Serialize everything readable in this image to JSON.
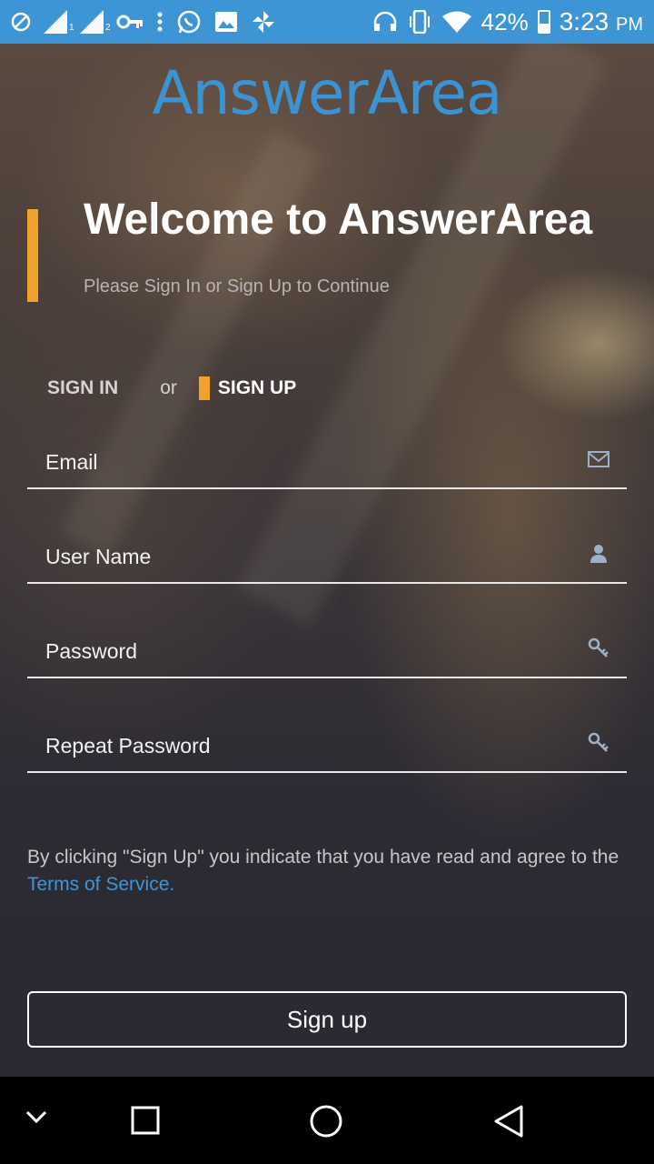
{
  "status_bar": {
    "sim1_label": "1",
    "sim2_label": "2",
    "battery": "42%",
    "time": "3:23",
    "ampm": "PM",
    "icons": [
      "blocked-icon",
      "signal-sim1-icon",
      "signal-sim2-icon",
      "vpn-key-icon",
      "more-icon",
      "whatsapp-icon",
      "gallery-icon",
      "pinwheel-icon",
      "headset-icon",
      "vibrate-icon",
      "wifi-icon",
      "battery-icon"
    ]
  },
  "app": {
    "logo": "AnswerArea",
    "welcome_title": "Welcome to AnswerArea",
    "subtitle": "Please Sign In or Sign Up to Continue",
    "tabs": {
      "sign_in": "SIGN IN",
      "or": "or",
      "sign_up": "SIGN UP"
    },
    "fields": {
      "email": {
        "placeholder": "Email",
        "icon": "envelope-icon"
      },
      "username": {
        "placeholder": "User Name",
        "icon": "user-icon"
      },
      "password": {
        "placeholder": "Password",
        "icon": "key-icon"
      },
      "repeat_password": {
        "placeholder": "Repeat Password",
        "icon": "key-icon"
      }
    },
    "terms_text": "By clicking \"Sign Up\" you indicate that you have read and agree to the",
    "terms_link": "Terms of Service.",
    "submit_label": "Sign up"
  },
  "colors": {
    "brand": "#3d93d2",
    "accent": "#f0a22c",
    "status_bar": "#3e95d6"
  },
  "nav": {
    "icons": [
      "chevron-down-icon",
      "recents-icon",
      "home-icon",
      "back-icon"
    ]
  }
}
